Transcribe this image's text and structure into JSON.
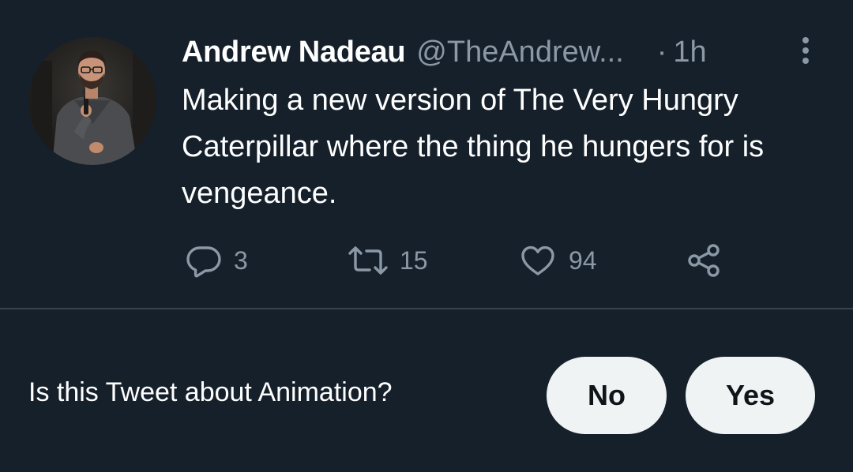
{
  "tweet": {
    "author_name": "Andrew Nadeau",
    "author_handle": "@TheAndrew...",
    "separator": "·",
    "timestamp": "1h",
    "text": "Making a new version of The Very Hungry Caterpillar where the thing he hungers for is vengeance.",
    "avatar_icon": "user-avatar-photo",
    "actions": {
      "reply": {
        "icon": "reply-bubble-icon",
        "count": "3"
      },
      "retweet": {
        "icon": "retweet-icon",
        "count": "15"
      },
      "like": {
        "icon": "heart-icon",
        "count": "94"
      },
      "share": {
        "icon": "share-icon"
      }
    },
    "more_icon": "vertical-ellipsis-icon"
  },
  "topic_prompt": {
    "question": "Is this Tweet about Animation?",
    "no_label": "No",
    "yes_label": "Yes"
  },
  "colors": {
    "background": "#15202b",
    "muted_text": "#8b98a5",
    "divider": "#38444d",
    "pill_background": "#eff3f4",
    "pill_text": "#0f1419"
  }
}
